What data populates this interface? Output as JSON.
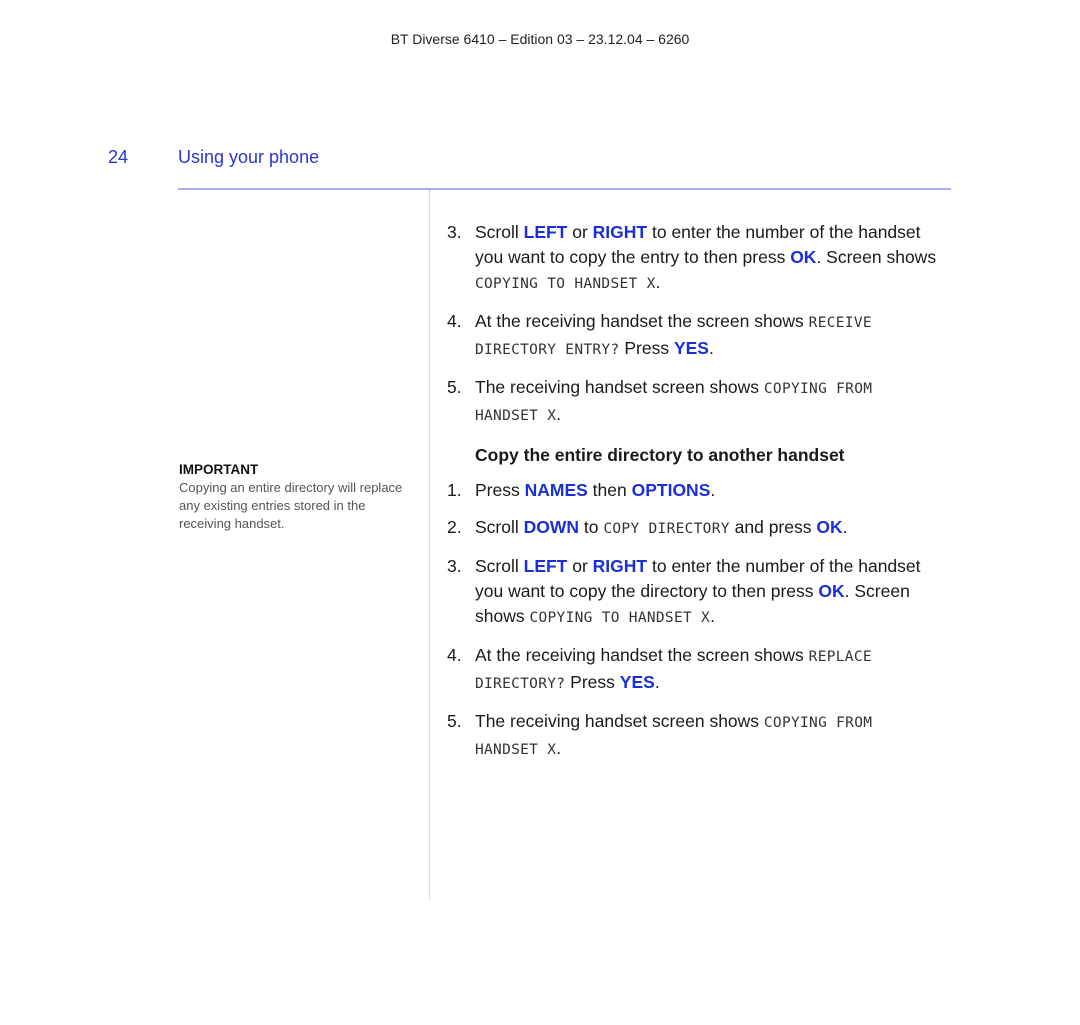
{
  "header": {
    "doc_id": "BT Diverse 6410 – Edition 03 – 23.12.04 – 6260"
  },
  "page": {
    "number": "24",
    "section": "Using your phone"
  },
  "colors": {
    "accent": "#2a37c9",
    "keyword": "#1a2fd6",
    "rule": "#a9adf2"
  },
  "sidebar": {
    "label": "IMPORTANT",
    "text": "Copying an entire directory will replace any existing entries stored in the receiving handset."
  },
  "entry_steps": [
    {
      "n": "3.",
      "parts": [
        [
          "t",
          "Scroll "
        ],
        [
          "k",
          "LEFT"
        ],
        [
          "t",
          " or "
        ],
        [
          "k",
          "RIGHT"
        ],
        [
          "t",
          " to enter the number of the handset you want to copy the entry to then press "
        ],
        [
          "k",
          "OK"
        ],
        [
          "t",
          ". Screen shows "
        ],
        [
          "l",
          "COPYING TO HANDSET X"
        ],
        [
          "t",
          "."
        ]
      ]
    },
    {
      "n": "4.",
      "parts": [
        [
          "t",
          "At the receiving handset the screen shows "
        ],
        [
          "l",
          "RECEIVE DIRECTORY ENTRY?"
        ],
        [
          "t",
          " Press "
        ],
        [
          "k",
          "YES"
        ],
        [
          "t",
          "."
        ]
      ]
    },
    {
      "n": "5.",
      "parts": [
        [
          "t",
          "The receiving handset screen shows "
        ],
        [
          "l",
          "COPYING FROM HANDSET X"
        ],
        [
          "t",
          "."
        ]
      ]
    }
  ],
  "subheading": "Copy the entire directory to another handset",
  "directory_steps": [
    {
      "n": "1.",
      "parts": [
        [
          "t",
          "Press "
        ],
        [
          "k",
          "NAMES"
        ],
        [
          "t",
          " then "
        ],
        [
          "k",
          "OPTIONS"
        ],
        [
          "t",
          "."
        ]
      ]
    },
    {
      "n": "2.",
      "parts": [
        [
          "t",
          "Scroll "
        ],
        [
          "k",
          "DOWN"
        ],
        [
          "t",
          " to "
        ],
        [
          "l",
          "COPY DIRECTORY"
        ],
        [
          "t",
          " and press "
        ],
        [
          "k",
          "OK"
        ],
        [
          "t",
          "."
        ]
      ]
    },
    {
      "n": "3.",
      "parts": [
        [
          "t",
          "Scroll "
        ],
        [
          "k",
          "LEFT"
        ],
        [
          "t",
          " or "
        ],
        [
          "k",
          "RIGHT"
        ],
        [
          "t",
          " to enter the number of the handset you want to copy the directory to then press "
        ],
        [
          "k",
          "OK"
        ],
        [
          "t",
          ". Screen shows "
        ],
        [
          "l",
          "COPYING TO HANDSET X"
        ],
        [
          "t",
          "."
        ]
      ]
    },
    {
      "n": "4.",
      "parts": [
        [
          "t",
          "At the receiving handset the screen shows "
        ],
        [
          "l",
          "REPLACE DIRECTORY?"
        ],
        [
          "t",
          " Press "
        ],
        [
          "k",
          "YES"
        ],
        [
          "t",
          "."
        ]
      ]
    },
    {
      "n": "5.",
      "parts": [
        [
          "t",
          "The receiving handset screen shows "
        ],
        [
          "l",
          "COPYING FROM HANDSET X"
        ],
        [
          "t",
          "."
        ]
      ]
    }
  ]
}
